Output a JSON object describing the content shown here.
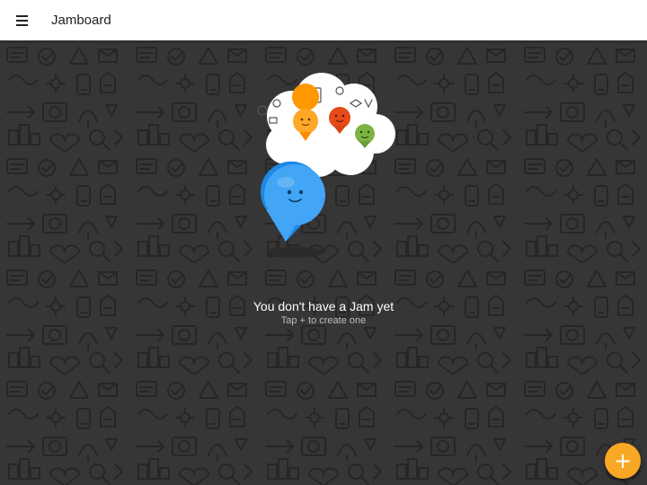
{
  "app": {
    "title": "Jamboard"
  },
  "empty_state": {
    "title": "You don't have a Jam yet",
    "subtitle": "Tap + to create one"
  },
  "fab": {
    "icon": "plus-icon",
    "label": "+"
  },
  "icons": {
    "menu": "menu-icon",
    "create": "plus-icon"
  },
  "colors": {
    "appbar_background": "#ffffff",
    "canvas_background": "#363636",
    "doodle_stroke": "#262626",
    "accent": "#f9a825",
    "pin_blue": "#42a5f5",
    "pin_orange": "#ff9800",
    "pin_red": "#e64a19",
    "pin_green": "#7cb342"
  }
}
